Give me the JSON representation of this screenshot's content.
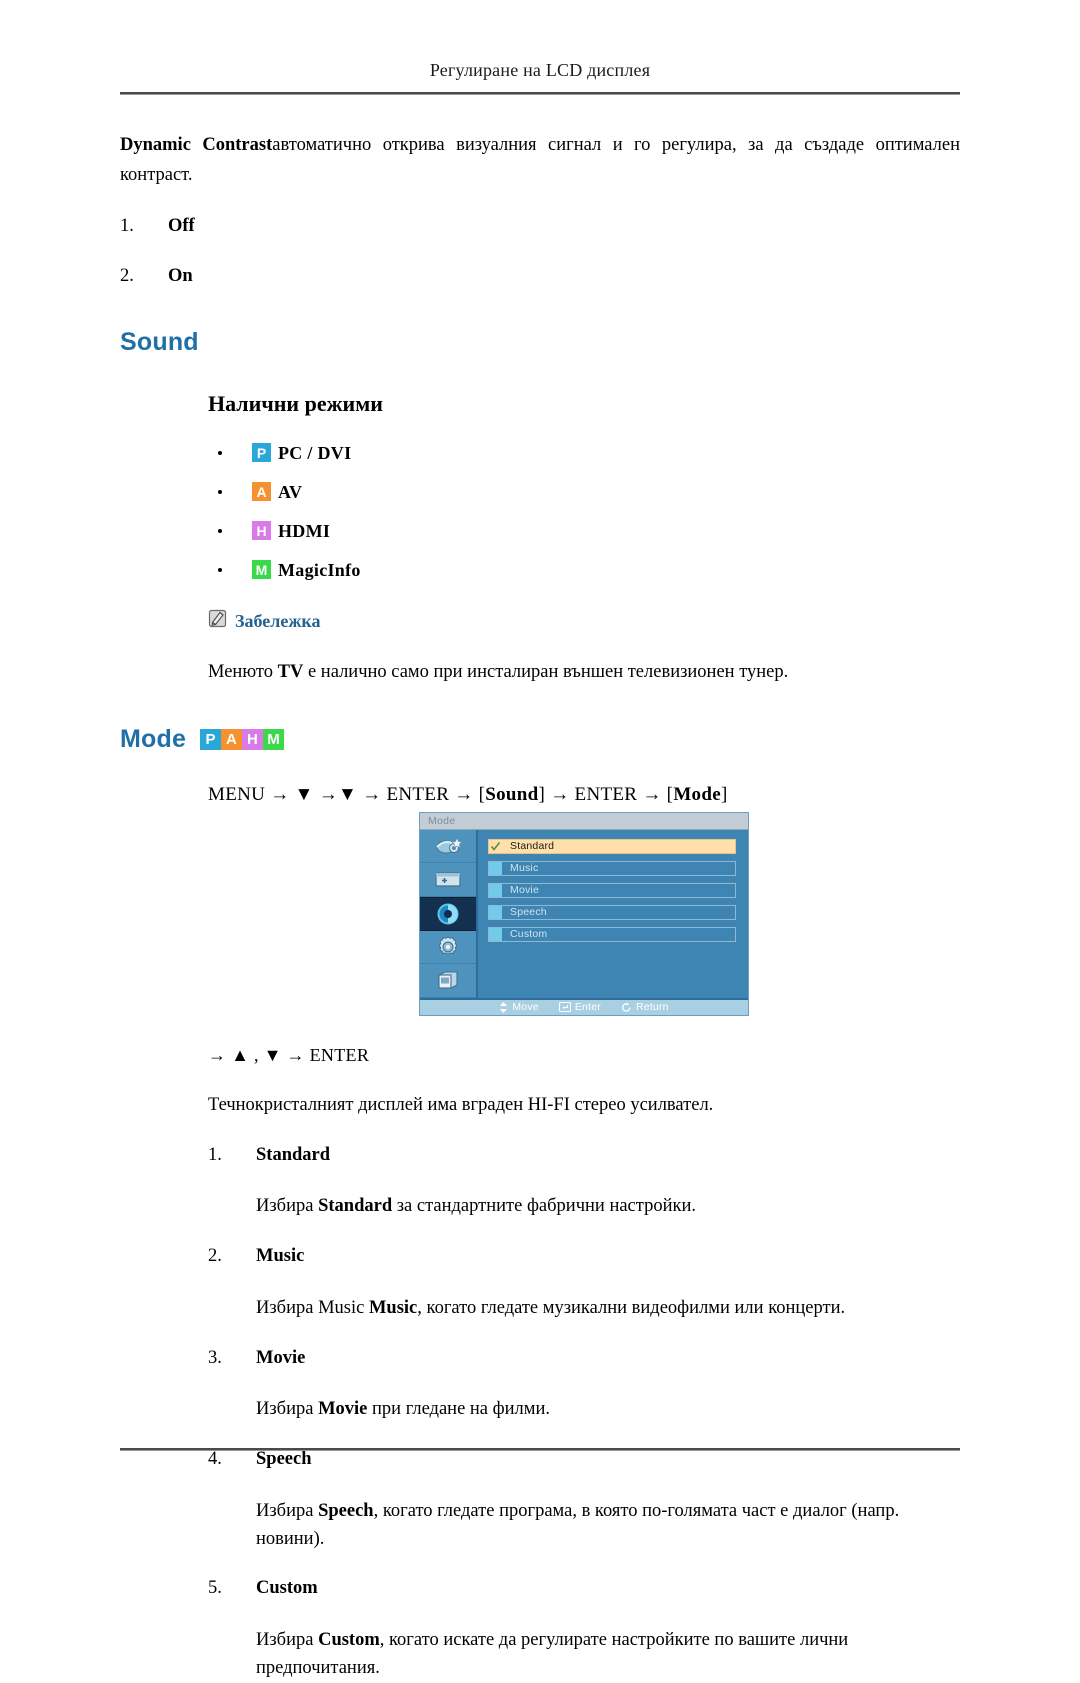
{
  "header": {
    "running_title": "Регулиране на LCD дисплея"
  },
  "intro": {
    "bold_lead": "Dynamic Contrast",
    "rest": "автоматично открива визуалния сигнал и го регулира, за да създаде оптимален контраст."
  },
  "dynamic_contrast_options": [
    {
      "num": "1.",
      "label": "Off"
    },
    {
      "num": "2.",
      "label": "On"
    }
  ],
  "sound_section": {
    "title": "Sound",
    "available_modes_title": "Налични режими",
    "modes": [
      {
        "badge": "P",
        "badge_color": "#29a8d8",
        "label": "PC / DVI",
        "icon_name": "pc-dvi-badge-icon"
      },
      {
        "badge": "A",
        "badge_color": "#f5922f",
        "label": "AV",
        "icon_name": "av-badge-icon"
      },
      {
        "badge": "H",
        "badge_color": "#d97ae8",
        "label": "HDMI",
        "icon_name": "hdmi-badge-icon"
      },
      {
        "badge": "M",
        "badge_color": "#3ad94a",
        "label": "MagicInfo",
        "icon_name": "magicinfo-badge-icon"
      }
    ],
    "note": {
      "title": "Забележка",
      "body_pre": "Менюто ",
      "body_bold": "TV",
      "body_post": " е налично само при инсталиран външен телевизионен тунер."
    }
  },
  "mode_section": {
    "title": "Mode",
    "badges": [
      {
        "letter": "P",
        "color": "#29a8d8",
        "icon_name": "pc-dvi-badge-icon"
      },
      {
        "letter": "A",
        "color": "#f5922f",
        "icon_name": "av-badge-icon"
      },
      {
        "letter": "H",
        "color": "#d97ae8",
        "icon_name": "hdmi-badge-icon"
      },
      {
        "letter": "M",
        "color": "#3ad94a",
        "icon_name": "magicinfo-badge-icon"
      }
    ],
    "menu_path": {
      "p1": "MENU → ▼ →▼ → ENTER → [",
      "b1": "Sound",
      "p2": "] → ENTER → [",
      "b2": "Mode",
      "p3": "]"
    },
    "key_path": "→ ▲ , ▼ → ENTER",
    "amplifier_note": "Течнокристалният дисплей има вграден HI-FI стерео усилвател.",
    "osd": {
      "title": "Mode",
      "rows": [
        {
          "label": "Standard",
          "selected": true
        },
        {
          "label": "Music",
          "selected": false
        },
        {
          "label": "Movie",
          "selected": false
        },
        {
          "label": "Speech",
          "selected": false
        },
        {
          "label": "Custom",
          "selected": false
        }
      ],
      "sidebar_icons": [
        {
          "name": "picture-icon",
          "selected": false
        },
        {
          "name": "screen-adjust-icon",
          "selected": false
        },
        {
          "name": "sound-icon",
          "selected": true
        },
        {
          "name": "setup-gear-icon",
          "selected": false
        },
        {
          "name": "multi-control-icon",
          "selected": false
        }
      ],
      "footer": [
        {
          "glyph": "move-arrows-icon",
          "label": "Move"
        },
        {
          "glyph": "enter-key-icon",
          "label": "Enter"
        },
        {
          "glyph": "return-arrow-icon",
          "label": "Return"
        }
      ]
    },
    "items": [
      {
        "num": "1.",
        "title": "Standard",
        "desc_pre": "Избира ",
        "desc_bold": "Standard",
        "desc_post": " за стандартните фабрични настройки."
      },
      {
        "num": "2.",
        "title": "Music",
        "desc_pre": "Избира Music ",
        "desc_bold": "Music",
        "desc_post": ", когато гледате музикални видеофилми или концерти."
      },
      {
        "num": "3.",
        "title": "Movie",
        "desc_pre": "Избира ",
        "desc_bold": "Movie",
        "desc_post": " при гледане на филми."
      },
      {
        "num": "4.",
        "title": "Speech",
        "desc_pre": "Избира ",
        "desc_bold": "Speech",
        "desc_post": ", когато гледате програма, в която по-голямата част е диалог (напр. новини)."
      },
      {
        "num": "5.",
        "title": "Custom",
        "desc_pre": "Избира ",
        "desc_bold": "Custom",
        "desc_post": ", когато искате да регулирате настройките по вашите лични предпочитания."
      }
    ]
  }
}
